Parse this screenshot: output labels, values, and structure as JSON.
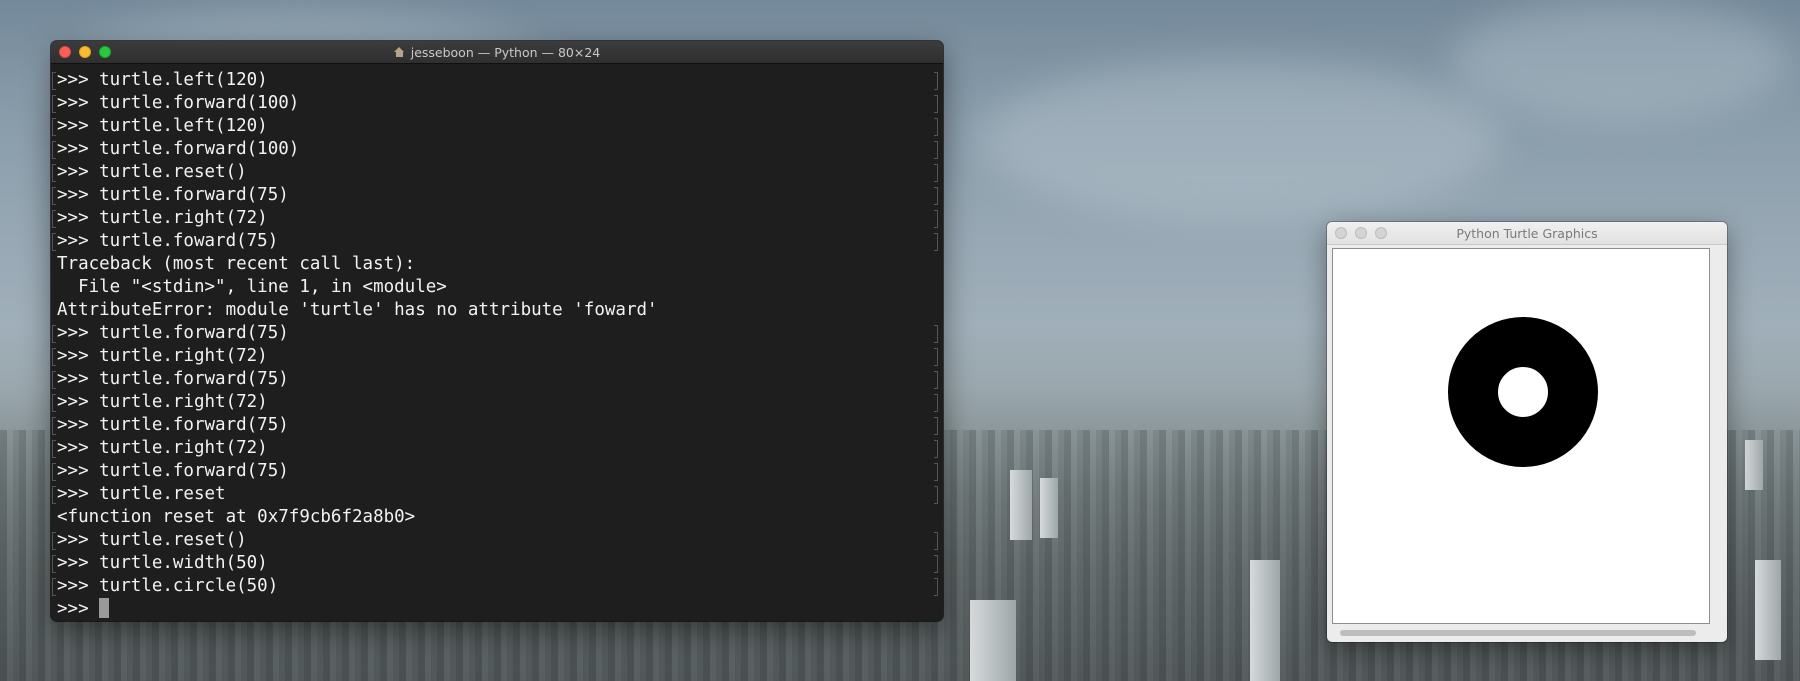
{
  "terminal": {
    "title": "jesseboon — Python — 80×24",
    "lines": [
      ">>> turtle.left(120)",
      ">>> turtle.forward(100)",
      ">>> turtle.left(120)",
      ">>> turtle.forward(100)",
      ">>> turtle.reset()",
      ">>> turtle.forward(75)",
      ">>> turtle.right(72)",
      ">>> turtle.foward(75)",
      "Traceback (most recent call last):",
      "  File \"<stdin>\", line 1, in <module>",
      "AttributeError: module 'turtle' has no attribute 'foward'",
      ">>> turtle.forward(75)",
      ">>> turtle.right(72)",
      ">>> turtle.forward(75)",
      ">>> turtle.right(72)",
      ">>> turtle.forward(75)",
      ">>> turtle.right(72)",
      ">>> turtle.forward(75)",
      ">>> turtle.reset",
      "<function reset at 0x7f9cb6f2a8b0>",
      ">>> turtle.reset()",
      ">>> turtle.width(50)",
      ">>> turtle.circle(50)"
    ],
    "prompt": ">>> "
  },
  "turtle_window": {
    "title": "Python Turtle Graphics",
    "drawing": {
      "shape": "circle",
      "radius": 50,
      "pen_width": 50,
      "color": "#000000",
      "background": "#ffffff"
    }
  },
  "colors": {
    "terminal_bg": "#1e1e1e",
    "terminal_text": "#f2f2f2",
    "close": "#fc5f57",
    "minimize": "#fdbc2e",
    "zoom": "#28c840"
  }
}
